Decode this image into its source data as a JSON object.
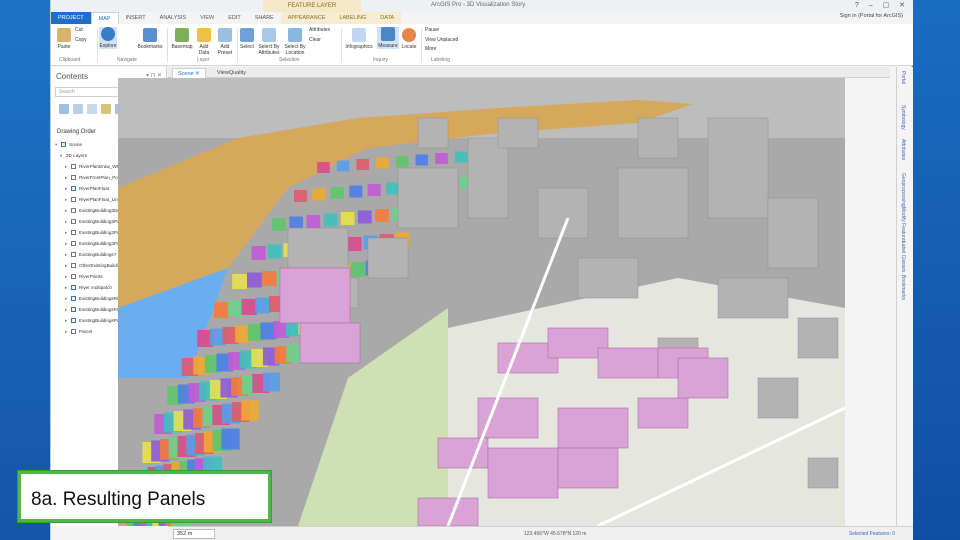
{
  "titlebar": {
    "context_tab": "FEATURE LAYER",
    "doc_title": "ArcGIS Pro - 3D Visualization Story",
    "window_controls": "? – ▢ ✕"
  },
  "tabs": [
    "PROJECT",
    "MAP",
    "INSERT",
    "ANALYSIS",
    "VIEW",
    "EDIT",
    "SHARE",
    "APPEARANCE",
    "LABELING",
    "DATA"
  ],
  "signin": "Sign in (Portal for ArcGIS)",
  "ribbon": {
    "buttons": [
      "Paste",
      "Cut",
      "Copy",
      "Explore",
      "Bookmarks",
      "Basemap",
      "Add Data",
      "Add Preset",
      "Select",
      "Select By Attributes",
      "Select By Location",
      "Attributes",
      "Clear",
      "Infographics",
      "Measure",
      "Locate",
      "Pause",
      "View Unplaced",
      "More"
    ],
    "groups": [
      "Clipboard",
      "Navigate",
      "Layer",
      "Selection",
      "Inquiry",
      "Labeling"
    ]
  },
  "left_panel": {
    "title": "Contents",
    "controls": "▾ ⊓ ✕",
    "search_placeholder": "Search",
    "drawing_order": "Drawing Order",
    "layers": [
      {
        "label": "Scene",
        "caret": "▾",
        "checked": true,
        "indent": 0
      },
      {
        "label": "3D Layers",
        "caret": "▾",
        "checked": null,
        "indent": 1
      },
      {
        "label": "RiverPlanDraw_WPoints",
        "caret": "▸",
        "checked": false,
        "indent": 2
      },
      {
        "label": "RiverFrontPlan_Points",
        "caret": "▸",
        "checked": false,
        "indent": 2
      },
      {
        "label": "RiverPlanFloat",
        "caret": "▸",
        "checked": true,
        "indent": 2
      },
      {
        "label": "RiverPlanFloat_Lines",
        "caret": "▸",
        "checked": false,
        "indent": 2
      },
      {
        "label": "ExistingBuilding3Deck_MPs",
        "caret": "▸",
        "checked": false,
        "indent": 2
      },
      {
        "label": "ExistingBuilding3Park_Lots",
        "caret": "▸",
        "checked": false,
        "indent": 2
      },
      {
        "label": "ExistingBuilding3Park_Lots2",
        "caret": "▸",
        "checked": false,
        "indent": 2
      },
      {
        "label": "ExistingBuilding3Parcel",
        "caret": "▸",
        "checked": false,
        "indent": 2
      },
      {
        "label": "ExistingBuildings?",
        "caret": "▸",
        "checked": false,
        "indent": 2
      },
      {
        "label": "OtherExistingBuildings",
        "caret": "▸",
        "checked": false,
        "indent": 2
      },
      {
        "label": "RiverPoints",
        "caret": "▸",
        "checked": false,
        "indent": 2
      },
      {
        "label": "River multipatch",
        "caret": "▸",
        "checked": true,
        "indent": 2
      },
      {
        "label": "ExistingBuildingsRiverLoney",
        "caret": "▸",
        "checked": true,
        "indent": 2
      },
      {
        "label": "ExistingBuildingsFirst",
        "caret": "▸",
        "checked": true,
        "indent": 2
      },
      {
        "label": "ExistingBuildingsPathsCampsite",
        "caret": "▸",
        "checked": true,
        "indent": 2
      },
      {
        "label": "Parcel",
        "caret": "▸",
        "checked": false,
        "indent": 2
      }
    ],
    "swatch_colors": [
      "#c99a3a",
      "#5fa8e8",
      "#1d8b6a",
      "#9fb4c8",
      "#d8a6d8"
    ]
  },
  "view_tabs": [
    "Scene",
    "ViewQuality"
  ],
  "right_dock": [
    "Portal",
    "Symbology",
    "Attributes",
    "Geoprocessing",
    "Modify Features",
    "Label Classes",
    "Bookmarks"
  ],
  "statusbar": {
    "scale": "352 m",
    "coords": "123.456°W 45.678°N  120 m",
    "selected": "Selected Features: 0"
  },
  "caption": "8a. Resulting Panels",
  "colors": {
    "river": "#6aaef2",
    "building": "#b3b3b3",
    "highlight": "#d9a3d6",
    "green_frame": "#4db848",
    "accent": "#1e6fc7"
  }
}
